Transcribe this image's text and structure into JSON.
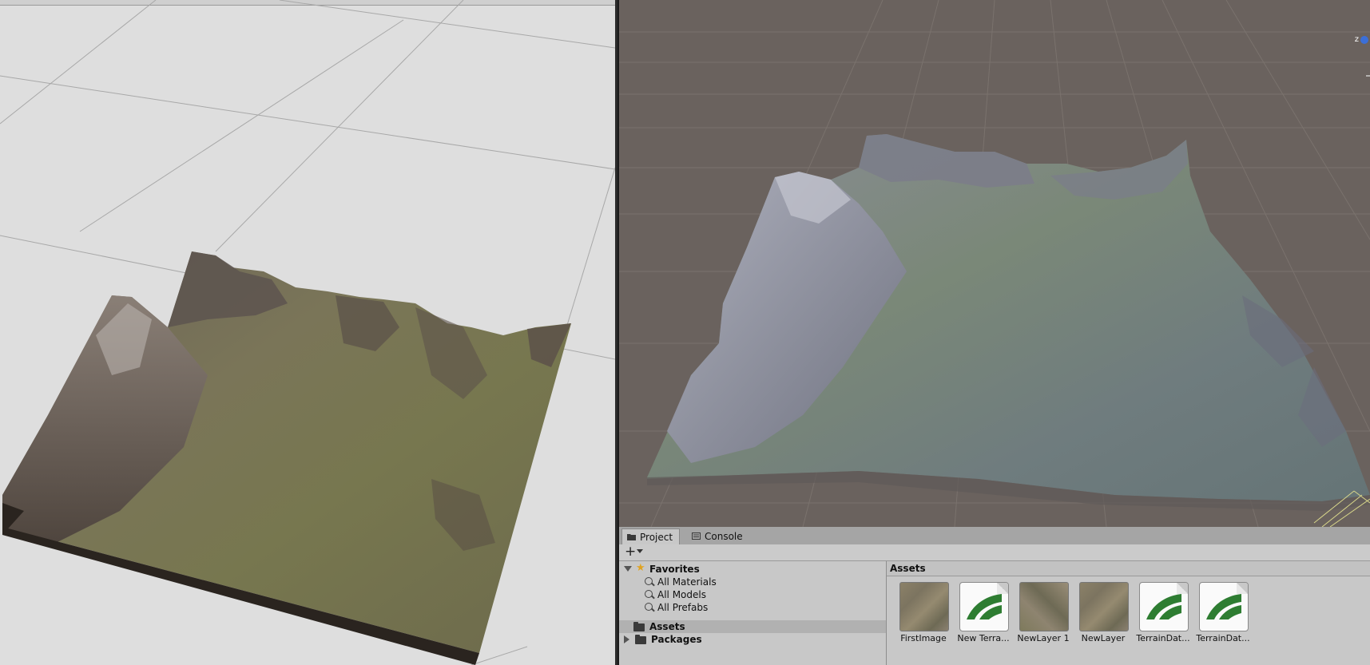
{
  "scene_gizmo": {
    "axis_label": "z"
  },
  "project_panel": {
    "tabs": [
      {
        "label": "Project",
        "icon": "folder-icon",
        "active": true
      },
      {
        "label": "Console",
        "icon": "console-icon",
        "active": false
      }
    ],
    "add_button": "+",
    "tree": {
      "favorites": {
        "label": "Favorites",
        "items": [
          "All Materials",
          "All Models",
          "All Prefabs"
        ]
      },
      "assets": {
        "label": "Assets"
      },
      "packages": {
        "label": "Packages"
      }
    },
    "assets_header": "Assets",
    "assets": [
      {
        "name": "FirstImage",
        "type": "texture"
      },
      {
        "name": "New Terra...",
        "type": "terrain-data"
      },
      {
        "name": "NewLayer 1",
        "type": "texture"
      },
      {
        "name": "NewLayer",
        "type": "texture"
      },
      {
        "name": "TerrainDat...",
        "type": "terrain-data"
      },
      {
        "name": "TerrainDat...",
        "type": "terrain-data"
      }
    ]
  },
  "colors": {
    "scene_background": "#6a625e",
    "left_background": "#dedede",
    "panel_background": "#c8c8c8",
    "favorite_star": "#e0a321",
    "terrain_icon_green": "#2e7d32"
  }
}
